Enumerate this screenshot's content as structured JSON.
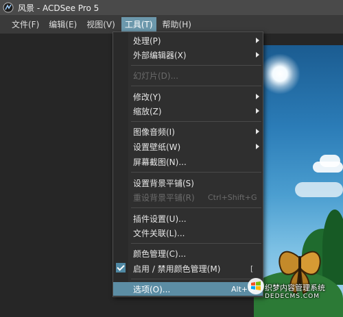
{
  "window": {
    "title": "风景 - ACDSee Pro 5"
  },
  "menubar": {
    "items": [
      "文件(F)",
      "编辑(E)",
      "视图(V)",
      "工具(T)",
      "帮助(H)"
    ]
  },
  "tools_menu": {
    "items": [
      {
        "label": "处理(P)",
        "submenu": true
      },
      {
        "label": "外部编辑器(X)",
        "submenu": true
      },
      {
        "label": "幻灯片(D)...",
        "disabled": true
      },
      {
        "label": "修改(Y)",
        "submenu": true
      },
      {
        "label": "缩放(Z)",
        "submenu": true
      },
      {
        "label": "图像音频(I)",
        "submenu": true
      },
      {
        "label": "设置壁纸(W)",
        "submenu": true
      },
      {
        "label": "屏幕截图(N)..."
      },
      {
        "label": "设置背景平铺(S)"
      },
      {
        "label": "重设背景平铺(R)",
        "shortcut": "Ctrl+Shift+G",
        "disabled": true
      },
      {
        "label": "插件设置(U)..."
      },
      {
        "label": "文件关联(L)..."
      },
      {
        "label": "颜色管理(C)..."
      },
      {
        "label": "启用 / 禁用颜色管理(M)",
        "shortcut": "[",
        "checked": true
      },
      {
        "label": "选项(O)...",
        "shortcut": "Alt+O",
        "highlighted": true
      }
    ]
  },
  "watermark": {
    "line1": "织梦内容管理系统",
    "line2": "DEDECMS.COM"
  },
  "colors": {
    "menu_highlight": "#5c8da4",
    "menubar_active": "#6c98ac",
    "checkmark_bg": "#4f88a3"
  },
  "icons": [
    "app-icon",
    "submenu-arrow-icon",
    "checkmark-icon",
    "windows-logo-icon"
  ]
}
